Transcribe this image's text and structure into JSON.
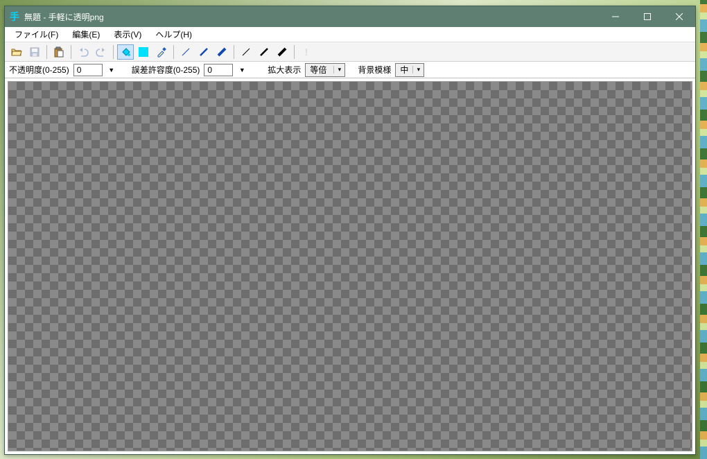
{
  "titlebar": {
    "title": "無題 - 手軽に透明png"
  },
  "menu": {
    "file": "ファイル(F)",
    "edit": "編集(E)",
    "view": "表示(V)",
    "help": "ヘルプ(H)"
  },
  "options": {
    "opacity_label": "不透明度(0-255)",
    "opacity_value": "0",
    "tolerance_label": "誤差許容度(0-255)",
    "tolerance_value": "0",
    "zoom_label": "拡大表示",
    "zoom_value": "等倍",
    "bg_label": "背景模様",
    "bg_value": "中"
  }
}
